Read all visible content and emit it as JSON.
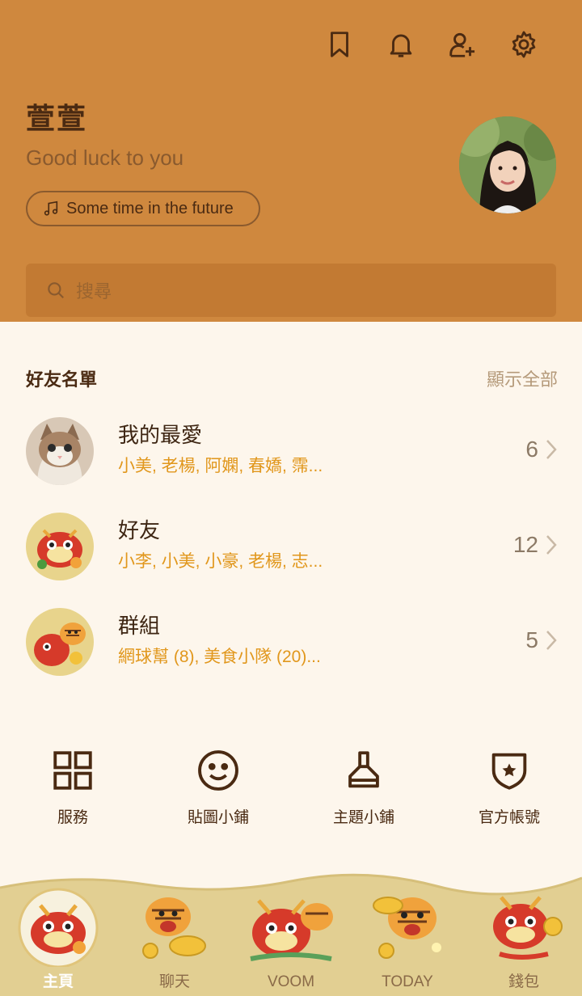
{
  "profile": {
    "name": "萱萱",
    "status_message": "Good luck to you",
    "music": "Some time in the future"
  },
  "top_icons": [
    "bookmark-icon",
    "bell-icon",
    "add-friend-icon",
    "settings-icon"
  ],
  "search": {
    "placeholder": "搜尋"
  },
  "friends": {
    "title": "好友名單",
    "show_all": "顯示全部",
    "groups": [
      {
        "name": "我的最愛",
        "members": "小美, 老楊, 阿嫻, 春嬌, 霈...",
        "count": "6"
      },
      {
        "name": "好友",
        "members": "小李, 小美, 小豪, 老楊, 志...",
        "count": "12"
      },
      {
        "name": "群組",
        "members": "網球幫 (8), 美食小隊 (20)...",
        "count": "5"
      }
    ]
  },
  "shortcuts": [
    {
      "label": "服務",
      "icon": "grid-icon"
    },
    {
      "label": "貼圖小鋪",
      "icon": "smiley-icon"
    },
    {
      "label": "主題小鋪",
      "icon": "brush-icon"
    },
    {
      "label": "官方帳號",
      "icon": "shield-star-icon"
    }
  ],
  "nav": [
    {
      "label": "主頁",
      "active": true
    },
    {
      "label": "聊天",
      "active": false
    },
    {
      "label": "VOOM",
      "active": false
    },
    {
      "label": "TODAY",
      "active": false
    },
    {
      "label": "錢包",
      "active": false
    }
  ],
  "colors": {
    "header_bg": "#cf883e",
    "body_bg": "#fdf6ec",
    "accent_orange": "#e1971c",
    "dark_brown": "#4a2a12"
  }
}
